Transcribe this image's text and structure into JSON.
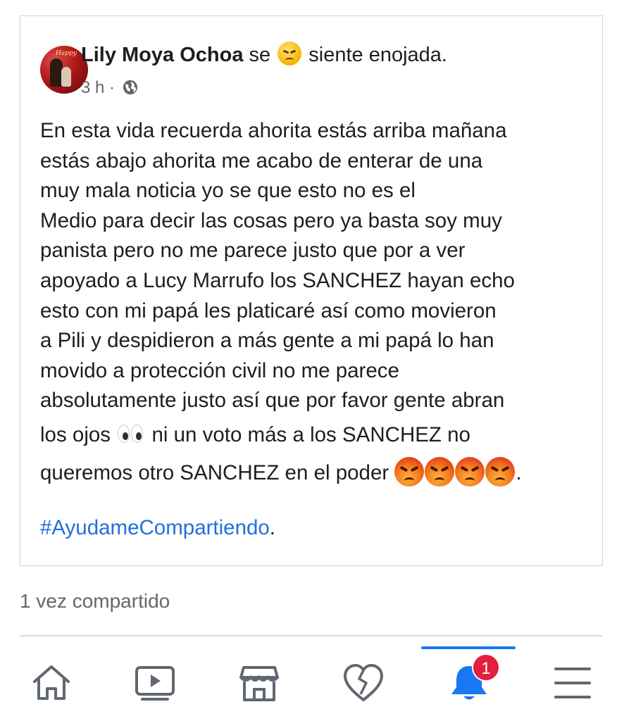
{
  "post": {
    "author": "Lily Moya Ochoa",
    "feeling_prefix": "se",
    "feeling_emoji": "angry-face-icon",
    "feeling_text": "siente enojada.",
    "time": "3 h",
    "separator": "·",
    "audience_icon": "globe-icon",
    "body_lines": [
      "En esta vida recuerda ahorita estás arriba mañana",
      "estás abajo ahorita me acabo de enterar de una",
      "muy mala noticia yo se que esto no es el",
      "Medio para decir las cosas pero ya basta soy muy",
      "panista pero no me parece justo que por a ver",
      "apoyado a Lucy Marrufo los SANCHEZ hayan echo",
      "esto con mi papá les platicaré así como movieron",
      "a Pili y despidieron a más gente a mi papá lo han",
      "movido a protección civil no me parece",
      "absolutamente justo así que por favor gente abran"
    ],
    "line_eyes_before": "los ojos",
    "line_eyes_after": "ni un voto más a los SANCHEZ no",
    "line_last": "queremos otro SANCHEZ en el poder",
    "line_last_end": ".",
    "hashtag": "#AyudameCompartiendo",
    "hashtag_end": "."
  },
  "shares": "1 vez compartido",
  "tabs": [
    {
      "icon": "home-icon"
    },
    {
      "icon": "video-icon"
    },
    {
      "icon": "marketplace-icon"
    },
    {
      "icon": "heart-icon"
    },
    {
      "icon": "bell-icon",
      "active": true,
      "badge": "1"
    },
    {
      "icon": "menu-icon"
    }
  ],
  "colors": {
    "hashtag": "#216fdb",
    "active_tab": "#1877f2",
    "badge": "#e41e3f",
    "secondary_text": "#65676b"
  }
}
